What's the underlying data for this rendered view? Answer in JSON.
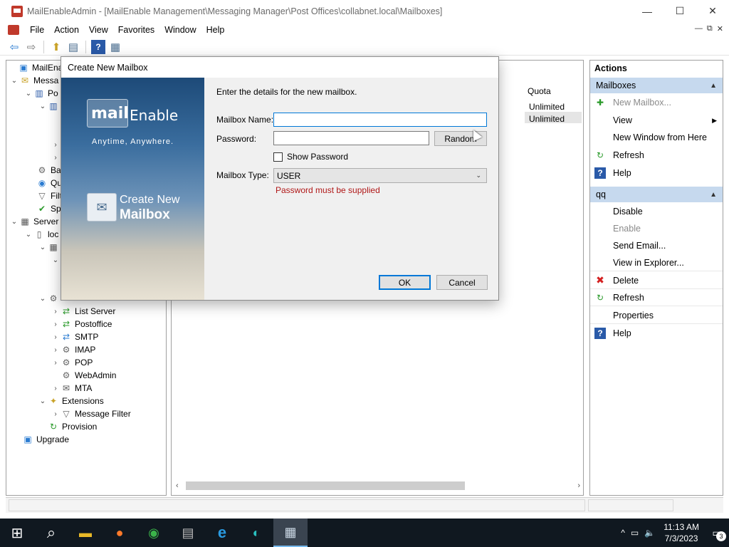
{
  "window": {
    "title": "MailEnableAdmin - [MailEnable Management\\Messaging Manager\\Post Offices\\collabnet.local\\Mailboxes]",
    "minimize_glyph": "—",
    "maximize_glyph": "☐",
    "close_glyph": "✕"
  },
  "menubar": {
    "items": [
      "File",
      "Action",
      "View",
      "Favorites",
      "Window",
      "Help"
    ],
    "mdi_controls": [
      "—",
      "⧉",
      "✕"
    ]
  },
  "toolbar": {
    "icons": [
      "back-arrow-icon",
      "forward-arrow-icon",
      "up-folder-icon",
      "show-hide-tree-icon",
      "help-icon",
      "action-pane-icon"
    ],
    "glyphs": [
      "⇦",
      "⇨",
      "⬆",
      "▤",
      "?",
      "▦"
    ]
  },
  "tree": {
    "items": [
      {
        "label": "MailEnable",
        "expander": "",
        "icon": "▣"
      },
      {
        "label": "Messa",
        "expander": "⌄",
        "icon": "✉"
      },
      {
        "label": "Po",
        "expander": "⌄",
        "icon": "▥"
      },
      {
        "label": "",
        "expander": "⌄",
        "icon": "▥"
      },
      {
        "label": "",
        "expander": "›",
        "icon": ""
      },
      {
        "label": "",
        "expander": "›",
        "icon": ""
      },
      {
        "label": "Ba",
        "expander": "",
        "icon": "⚙"
      },
      {
        "label": "Qu",
        "expander": "",
        "icon": "◉"
      },
      {
        "label": "Filt",
        "expander": "",
        "icon": "▽"
      },
      {
        "label": "Sp",
        "expander": "",
        "icon": "✔"
      },
      {
        "label": "Server",
        "expander": "⌄",
        "icon": "▦"
      },
      {
        "label": "loc",
        "expander": "⌄",
        "icon": "▯"
      },
      {
        "label": "",
        "expander": "⌄",
        "icon": "▦"
      },
      {
        "label": "",
        "expander": "⌄",
        "icon": ""
      },
      {
        "label": "",
        "expander": "⌄",
        "icon": "⚙"
      },
      {
        "label": "List Server",
        "expander": "›",
        "icon": "⇄"
      },
      {
        "label": "Postoffice",
        "expander": "›",
        "icon": "⇄"
      },
      {
        "label": "SMTP",
        "expander": "›",
        "icon": "⇄"
      },
      {
        "label": "IMAP",
        "expander": "›",
        "icon": "⚙"
      },
      {
        "label": "POP",
        "expander": "›",
        "icon": "⚙"
      },
      {
        "label": "WebAdmin",
        "expander": "",
        "icon": "⚙"
      },
      {
        "label": "MTA",
        "expander": "›",
        "icon": "✉"
      },
      {
        "label": "Extensions",
        "expander": "⌄",
        "icon": "✦"
      },
      {
        "label": "Message Filter",
        "expander": "›",
        "icon": "▽"
      },
      {
        "label": "Provision",
        "expander": "",
        "icon": "↻"
      },
      {
        "label": "Upgrade",
        "expander": "",
        "icon": "▣"
      }
    ]
  },
  "center": {
    "column_header": "Quota",
    "rows": [
      "Unlimited",
      "Unlimited"
    ],
    "scroll_left": "‹",
    "scroll_right": "›"
  },
  "actions": {
    "title": "Actions",
    "section1": {
      "label": "Mailboxes",
      "caret": "▲",
      "items": [
        {
          "label": "New Mailbox...",
          "icon": "✚",
          "disabled": true
        },
        {
          "label": "View",
          "icon": "",
          "submenu": "▶"
        },
        {
          "label": "New Window from Here",
          "icon": ""
        },
        {
          "label": "Refresh",
          "icon": "↻"
        },
        {
          "label": "Help",
          "icon": "?"
        }
      ]
    },
    "section2": {
      "label": "qq",
      "caret": "▲",
      "items": [
        {
          "label": "Disable",
          "icon": ""
        },
        {
          "label": "Enable",
          "icon": "",
          "disabled": true
        },
        {
          "label": "Send Email...",
          "icon": ""
        },
        {
          "label": "View in Explorer...",
          "icon": ""
        },
        {
          "label": "Delete",
          "icon": "✖"
        },
        {
          "label": "Refresh",
          "icon": "↻"
        },
        {
          "label": "Properties",
          "icon": ""
        },
        {
          "label": "Help",
          "icon": "?"
        }
      ]
    }
  },
  "dialog": {
    "title": "Create New Mailbox",
    "banner": {
      "logo_mail": "mail",
      "logo_enable": "Enable",
      "tagline": "Anytime, Anywhere.",
      "line1": "Create New",
      "line2": "Mailbox"
    },
    "intro": "Enter the details for the new mailbox.",
    "mailbox_name_label": "Mailbox Name:",
    "mailbox_name_value": "",
    "password_label": "Password:",
    "password_value": "",
    "random_button": "Random",
    "show_password_label": "Show Password",
    "show_password_checked": false,
    "mailbox_type_label": "Mailbox Type:",
    "mailbox_type_value": "USER",
    "select_arrow": "⌄",
    "error": "Password must be supplied",
    "ok_button": "OK",
    "cancel_button": "Cancel"
  },
  "taskbar": {
    "items": [
      "windows-start-icon",
      "search-icon",
      "file-explorer-icon",
      "firefox-icon",
      "chrome-icon",
      "server-manager-icon",
      "internet-explorer-icon",
      "edge-icon",
      "mailenable-admin-icon"
    ],
    "glyphs": [
      "⊞",
      "⌕",
      "▬",
      "●",
      "◉",
      "▤",
      "e",
      "◐",
      "▦"
    ],
    "tray_glyphs": [
      "^",
      "▭",
      "🔈"
    ],
    "time": "11:13 AM",
    "date": "7/3/2023",
    "notification_glyph": "▭",
    "notification_count": "3"
  },
  "colors": {
    "accent": "#0078d7",
    "section_header": "#c6d9ee",
    "error": "#b01818",
    "taskbar": "#101820"
  }
}
